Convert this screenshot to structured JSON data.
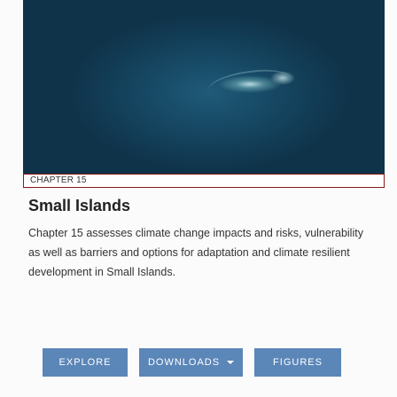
{
  "card": {
    "chapter_label": "CHAPTER 15",
    "title": "Small Islands",
    "description": "Chapter 15 assesses climate change impacts and risks, vulnerability as well as barriers and options for adaptation and climate resilient development in Small Islands."
  },
  "buttons": {
    "explore": "EXPLORE",
    "downloads": "DOWNLOADS",
    "figures": "FIGURES"
  },
  "colors": {
    "button_bg": "#5b86b8",
    "chapter_border": "#8b1a1a",
    "hero_ocean": "#174a66"
  },
  "icons": {
    "downloads_caret": "caret-down-icon"
  }
}
